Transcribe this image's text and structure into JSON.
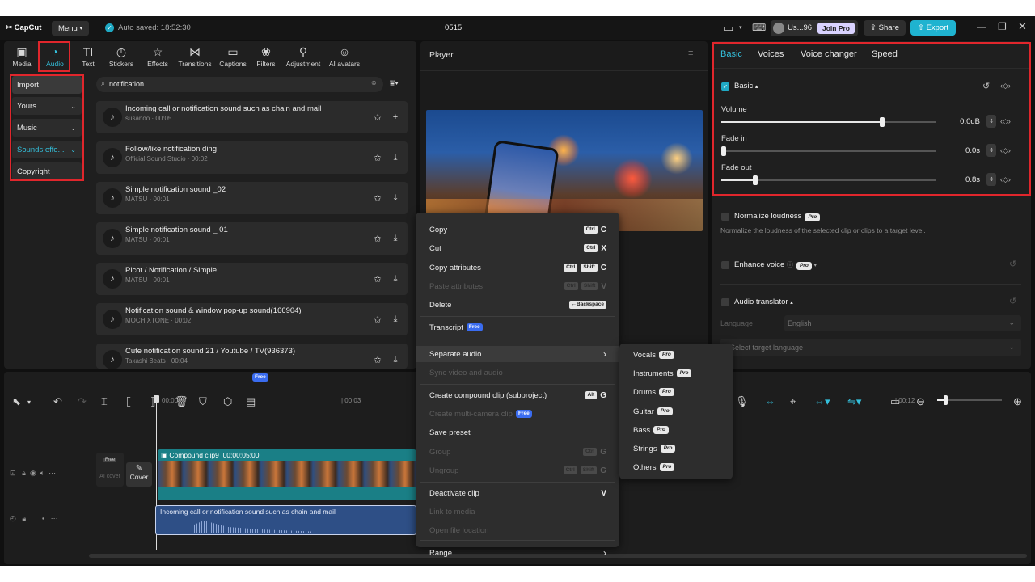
{
  "app": {
    "logo": "CapCut",
    "menu_label": "Menu",
    "autosave": "Auto saved: 18:52:30",
    "project_title": "0515"
  },
  "topbar_right": {
    "user": "Us...96",
    "join_pro": "Join Pro",
    "share": "Share",
    "export": "Export"
  },
  "toolbar": {
    "items": [
      {
        "label": "Media",
        "icon": "media-icon"
      },
      {
        "label": "Audio",
        "icon": "audio-icon"
      },
      {
        "label": "Text",
        "icon": "text-icon"
      },
      {
        "label": "Stickers",
        "icon": "sticker-icon"
      },
      {
        "label": "Effects",
        "icon": "effects-icon"
      },
      {
        "label": "Transitions",
        "icon": "transitions-icon"
      },
      {
        "label": "Captions",
        "icon": "captions-icon"
      },
      {
        "label": "Filters",
        "icon": "filters-icon"
      },
      {
        "label": "Adjustment",
        "icon": "adjustment-icon"
      },
      {
        "label": "AI avatars",
        "icon": "ai-avatar-icon"
      }
    ],
    "active": "Audio"
  },
  "audio_sidebar": {
    "items": [
      "Import",
      "Yours",
      "Music",
      "Sounds effe...",
      "Copyright"
    ]
  },
  "search": {
    "value": "notification"
  },
  "sounds": [
    {
      "title": "Incoming call or notification sound such as chain and mail",
      "meta": "susanoo · 00:05"
    },
    {
      "title": "Follow/like notification ding",
      "meta": "Official Sound Studio · 00:02"
    },
    {
      "title": "Simple notification sound _02",
      "meta": "MATSU · 00:01"
    },
    {
      "title": "Simple notification sound _ 01",
      "meta": "MATSU · 00:01"
    },
    {
      "title": "Picot / Notification / Simple",
      "meta": "MATSU · 00:01"
    },
    {
      "title": "Notification sound & window pop-up sound(166904)",
      "meta": "MOCHIXTONE · 00:02"
    },
    {
      "title": "Cute notification sound 21 / Youtube / TV(936373)",
      "meta": "Takashi Beats · 00:04"
    }
  ],
  "player": {
    "title": "Player"
  },
  "context_menu": {
    "copy": "Copy",
    "cut": "Cut",
    "copy_attributes": "Copy attributes",
    "paste_attributes": "Paste attributes",
    "delete": "Delete",
    "transcript": "Transcript",
    "separate_audio": "Separate audio",
    "sync": "Sync video and audio",
    "compound": "Create compound clip (subproject)",
    "multicam": "Create multi-camera clip",
    "save_preset": "Save preset",
    "group": "Group",
    "ungroup": "Ungroup",
    "deactivate": "Deactivate clip",
    "link": "Link to media",
    "open_location": "Open file location",
    "range": "Range",
    "key_ctrl": "Ctrl",
    "key_shift": "Shift",
    "key_alt": "Alt",
    "key_backspace": "←Backspace",
    "letter_c": "C",
    "letter_x": "X",
    "letter_v": "V",
    "letter_g": "G",
    "free_badge": "Free"
  },
  "submenu": {
    "items": [
      "Vocals",
      "Instruments",
      "Drums",
      "Guitar",
      "Bass",
      "Strings",
      "Others"
    ],
    "pro_badge": "Pro"
  },
  "right_panel": {
    "tabs": [
      "Basic",
      "Voices",
      "Voice changer",
      "Speed"
    ],
    "basic_label": "Basic",
    "volume_label": "Volume",
    "volume_value": "0.0dB",
    "volume_level": 0.75,
    "fadein_label": "Fade in",
    "fadein_value": "0.0s",
    "fadein_level": 0.0,
    "fadeout_label": "Fade out",
    "fadeout_value": "0.8s",
    "fadeout_level": 0.16,
    "normalize_label": "Normalize loudness",
    "normalize_desc": "Normalize the loudness of the selected clip or clips to a target level.",
    "enhance_label": "Enhance voice",
    "translator_label": "Audio translator",
    "language_label": "Language",
    "language_value": "English",
    "target_placeholder": "Select target language"
  },
  "timeline": {
    "time_0": "00:00",
    "time_3": "| 00:03",
    "time_12": "| 00:12",
    "compound_clip": "Compound clip9",
    "compound_duration": "00:00:05:00",
    "audio_clip": "Incoming call or notification sound such as chain and mail",
    "cover_label": "Cover",
    "free_badge": "Free",
    "ai_label": "AI cover"
  }
}
